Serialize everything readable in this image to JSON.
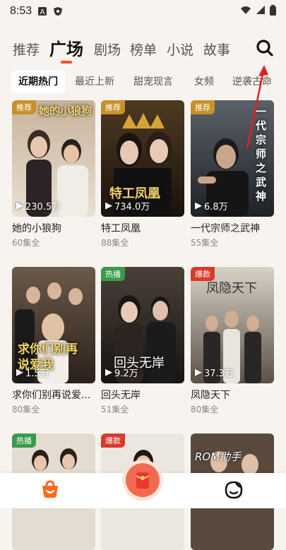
{
  "status": {
    "time": "8:53"
  },
  "nav": {
    "tabs": [
      "推荐",
      "广场",
      "剧场",
      "榜单",
      "小说",
      "故事"
    ],
    "active_tab": "广场"
  },
  "chips": [
    "近期热门",
    "最近上新",
    "甜宠现言",
    "女频",
    "逆袭古命"
  ],
  "cards": [
    {
      "title": "她的小狼狗",
      "episodes": "60集全",
      "views": "230.5万",
      "badge": "推荐",
      "badge_color": "#c8902a",
      "poster_text": "她的小狼狗"
    },
    {
      "title": "特工凤凰",
      "episodes": "88集全",
      "views": "734.0万",
      "badge": "推荐",
      "badge_color": "#c8902a",
      "poster_text": "特工凤凰"
    },
    {
      "title": "一代宗师之武神",
      "episodes": "55集全",
      "views": "6.8万",
      "badge": "推荐",
      "badge_color": "#c8902a",
      "poster_text": "一代宗师之武神"
    },
    {
      "title": "求你们别再说爱...",
      "episodes": "80集全",
      "views": "1.5万",
      "badge": "",
      "badge_color": "",
      "poster_text": "求你们别再说爱我"
    },
    {
      "title": "回头无岸",
      "episodes": "51集全",
      "views": "9.2万",
      "badge": "热播",
      "badge_color": "#3a9a4a",
      "poster_text": "回头无岸"
    },
    {
      "title": "凤隐天下",
      "episodes": "80集全",
      "views": "37.3万",
      "badge": "爆款",
      "badge_color": "#d83a2a",
      "poster_text": "凤隐天下"
    },
    {
      "title": "",
      "episodes": "",
      "views": "",
      "badge": "热播",
      "badge_color": "#3a9a4a",
      "poster_text": ""
    },
    {
      "title": "",
      "episodes": "",
      "views": "",
      "badge": "爆款",
      "badge_color": "#d83a2a",
      "poster_text": ""
    },
    {
      "title": "",
      "episodes": "",
      "views": "",
      "badge": "",
      "badge_color": "",
      "poster_text": ""
    }
  ],
  "watermark": "ROM助手",
  "colors": {
    "accent": "#ff4d2a",
    "background": "#f7f4f0"
  }
}
